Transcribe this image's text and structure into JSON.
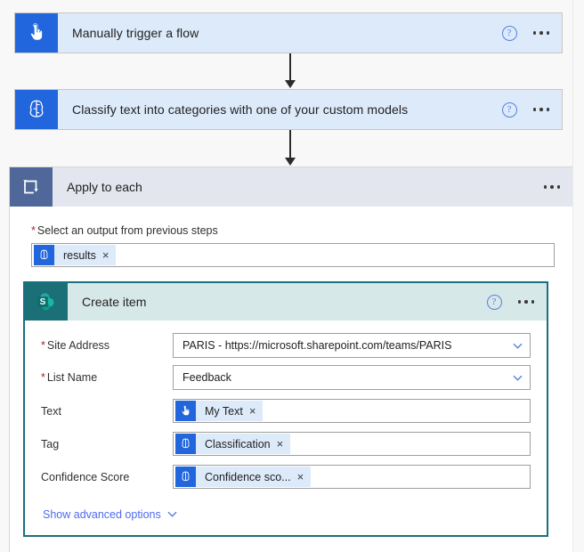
{
  "flow": {
    "trigger": {
      "title": "Manually trigger a flow",
      "icon": "touch-hand-icon",
      "icon_color": "#2266dd",
      "help_label": "?",
      "menu_label": "..."
    },
    "action_classify": {
      "title": "Classify text into categories with one of your custom models",
      "icon": "ai-builder-brain-icon",
      "icon_color": "#2266dd",
      "help_label": "?",
      "menu_label": "..."
    },
    "scope": {
      "title": "Apply to each",
      "icon": "loop-repeat-icon",
      "icon_color": "#4f6899",
      "menu_label": "...",
      "output_field": {
        "required_marker": "*",
        "label": "Select an output from previous steps",
        "token": {
          "text": "results",
          "icon": "ai-builder-brain-icon",
          "remove_label": "×"
        }
      }
    },
    "sharepoint_card": {
      "title": "Create item",
      "icon": "sharepoint-icon",
      "icon_color": "#1b6f76",
      "border_color": "#177080",
      "help_label": "?",
      "menu_label": "...",
      "fields": [
        {
          "label": "Site Address",
          "required": true,
          "type": "select",
          "value": "PARIS - https://microsoft.sharepoint.com/teams/PARIS",
          "chevron": "chevron-down-icon"
        },
        {
          "label": "List Name",
          "required": true,
          "type": "select",
          "value": "Feedback",
          "chevron": "chevron-down-icon"
        },
        {
          "label": "Text",
          "required": false,
          "type": "token",
          "token": {
            "text": "My Text",
            "icon": "touch-hand-icon",
            "icon_color": "#2266dd",
            "remove_label": "×"
          }
        },
        {
          "label": "Tag",
          "required": false,
          "type": "token",
          "token": {
            "text": "Classification",
            "icon": "ai-builder-brain-icon",
            "icon_color": "#2266dd",
            "remove_label": "×"
          }
        },
        {
          "label": "Confidence Score",
          "required": false,
          "type": "token",
          "token": {
            "text": "Confidence sco...",
            "icon": "ai-builder-brain-icon",
            "icon_color": "#2266dd",
            "remove_label": "×"
          }
        }
      ],
      "advanced_options": {
        "label": "Show advanced options",
        "chevron": "chevron-down-icon"
      }
    }
  }
}
